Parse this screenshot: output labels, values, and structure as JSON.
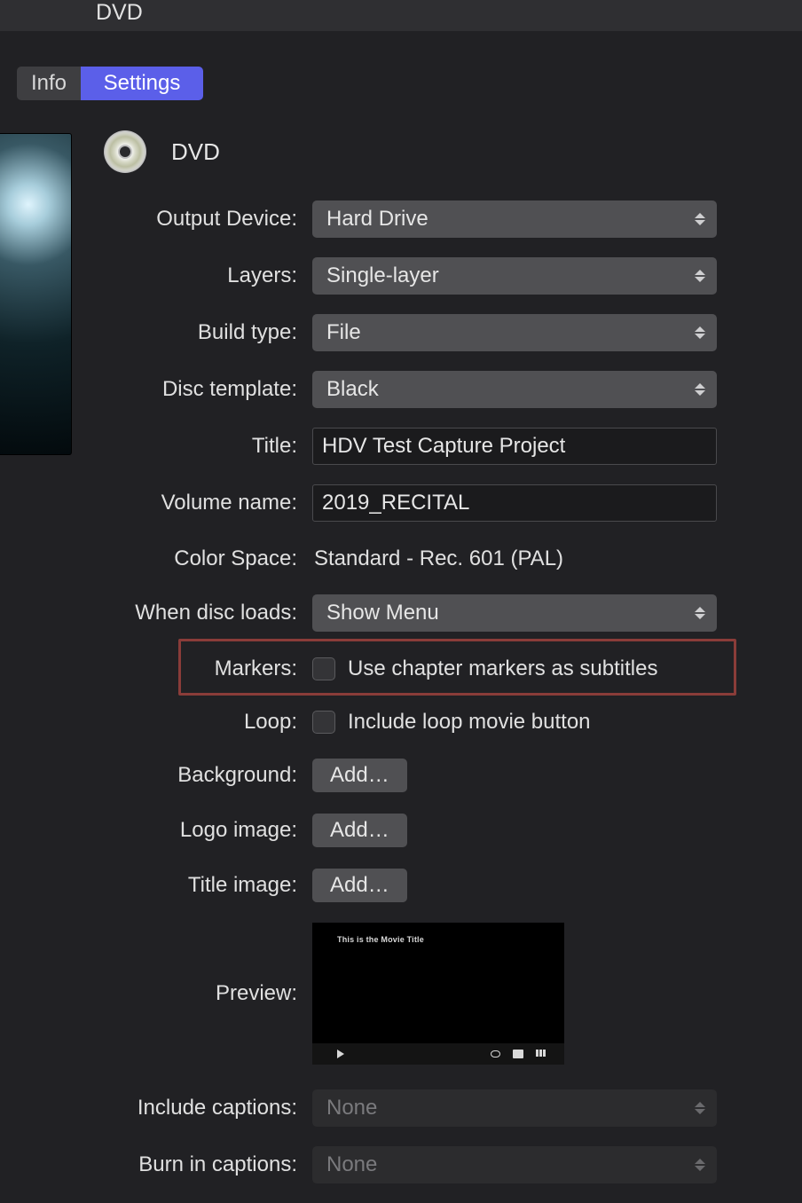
{
  "header": {
    "title": "DVD"
  },
  "tabs": {
    "info": "Info",
    "settings": "Settings"
  },
  "section": {
    "title": "DVD"
  },
  "form": {
    "output_device": {
      "label": "Output Device:",
      "value": "Hard Drive"
    },
    "layers": {
      "label": "Layers:",
      "value": "Single-layer"
    },
    "build_type": {
      "label": "Build type:",
      "value": "File"
    },
    "disc_template": {
      "label": "Disc template:",
      "value": "Black"
    },
    "title": {
      "label": "Title:",
      "value": "HDV Test Capture Project"
    },
    "volume_name": {
      "label": "Volume name:",
      "value": "2019_RECITAL"
    },
    "color_space": {
      "label": "Color Space:",
      "value": "Standard - Rec. 601 (PAL)"
    },
    "when_disc_loads": {
      "label": "When disc loads:",
      "value": "Show Menu"
    },
    "markers": {
      "label": "Markers:",
      "checkbox_label": "Use chapter markers as subtitles"
    },
    "loop": {
      "label": "Loop:",
      "checkbox_label": "Include loop movie button"
    },
    "background": {
      "label": "Background:",
      "button": "Add…"
    },
    "logo_image": {
      "label": "Logo image:",
      "button": "Add…"
    },
    "title_image": {
      "label": "Title image:",
      "button": "Add…"
    },
    "preview": {
      "label": "Preview:",
      "inner_title": "This is the Movie Title"
    },
    "include_captions": {
      "label": "Include captions:",
      "value": "None"
    },
    "burn_in_captions": {
      "label": "Burn in captions:",
      "value": "None"
    }
  }
}
